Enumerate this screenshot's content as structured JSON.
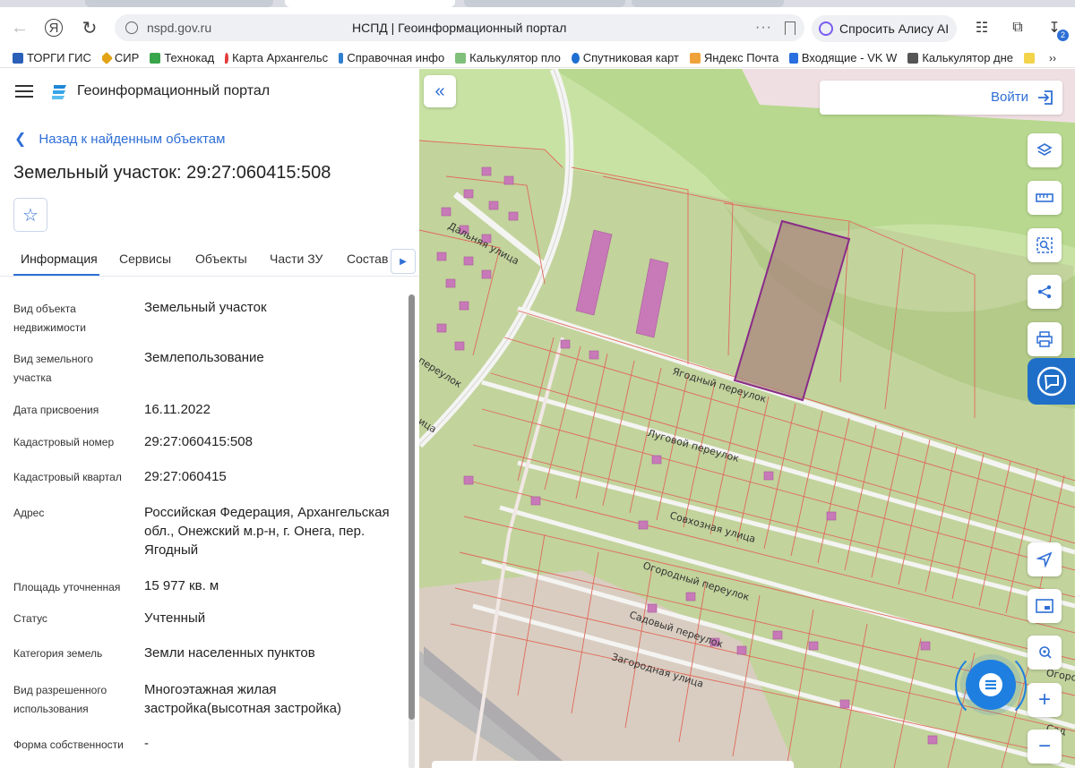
{
  "browser": {
    "url": "nspd.gov.ru",
    "page_title": "НСПД | Геоинформационный портал",
    "alice_label": "Спросить Алису AI",
    "downloads_count": "2"
  },
  "bookmarks": [
    {
      "label": "ТОРГИ ГИС",
      "color": "#2b5fb8"
    },
    {
      "label": "СИР",
      "color": "#e2a316"
    },
    {
      "label": "Технокад",
      "color": "#3aa54a"
    },
    {
      "label": "Карта Архангельс",
      "color": "#e23b3b"
    },
    {
      "label": "Справочная инфо",
      "color": "#2f7fd0"
    },
    {
      "label": "Калькулятор пло",
      "color": "#7fc07a"
    },
    {
      "label": "Спутниковая карт",
      "color": "#1e6fd0"
    },
    {
      "label": "Яндекс Почта",
      "color": "#f0a23a"
    },
    {
      "label": "Входящие - VK W",
      "color": "#2a6fe0"
    },
    {
      "label": "Калькулятор дне",
      "color": "#555555"
    }
  ],
  "portal": {
    "name": "Геоинформационный портал",
    "back_label": "Назад к найденным объектам",
    "object_title": "Земельный участок: 29:27:060415:508"
  },
  "tabs": [
    "Информация",
    "Сервисы",
    "Объекты",
    "Части ЗУ",
    "Состав"
  ],
  "properties": [
    {
      "label": "Вид объекта недвижимости",
      "value": "Земельный участок"
    },
    {
      "label": "Вид земельного участка",
      "value": "Землепользование"
    },
    {
      "label": "Дата присвоения",
      "value": "16.11.2022"
    },
    {
      "label": "Кадастровый номер",
      "value": "29:27:060415:508"
    },
    {
      "label": "Кадастровый квартал",
      "value": "29:27:060415"
    },
    {
      "label": "Адрес",
      "value": "Российская Федерация, Архангельская обл., Онежский м.р-н, г. Онега, пер. Ягодный"
    },
    {
      "label": "Площадь уточненная",
      "value": "15 977 кв. м"
    },
    {
      "label": "Статус",
      "value": "Учтенный"
    },
    {
      "label": "Категория земель",
      "value": "Земли населенных пунктов"
    },
    {
      "label": "Вид разрешенного использования",
      "value": "Многоэтажная жилая застройка(высотная застройка)"
    },
    {
      "label": "Форма собственности",
      "value": "-"
    }
  ],
  "map": {
    "login_label": "Войти",
    "street_labels": [
      {
        "text": "Дальняя улица"
      },
      {
        "text": "переулок"
      },
      {
        "text": "Ягодный переулок"
      },
      {
        "text": "Луговой переулок"
      },
      {
        "text": "Совхозная улица"
      },
      {
        "text": "Огородный переулок"
      },
      {
        "text": "Садовый переулок"
      },
      {
        "text": "Загородная улица"
      },
      {
        "text": "Огородный"
      },
      {
        "text": "Сад"
      },
      {
        "text": "ица"
      }
    ],
    "colors": {
      "accent": "#2f6fd6",
      "parcel_line": "#e06a5a",
      "selected_parcel": "#8a2a8a"
    }
  }
}
